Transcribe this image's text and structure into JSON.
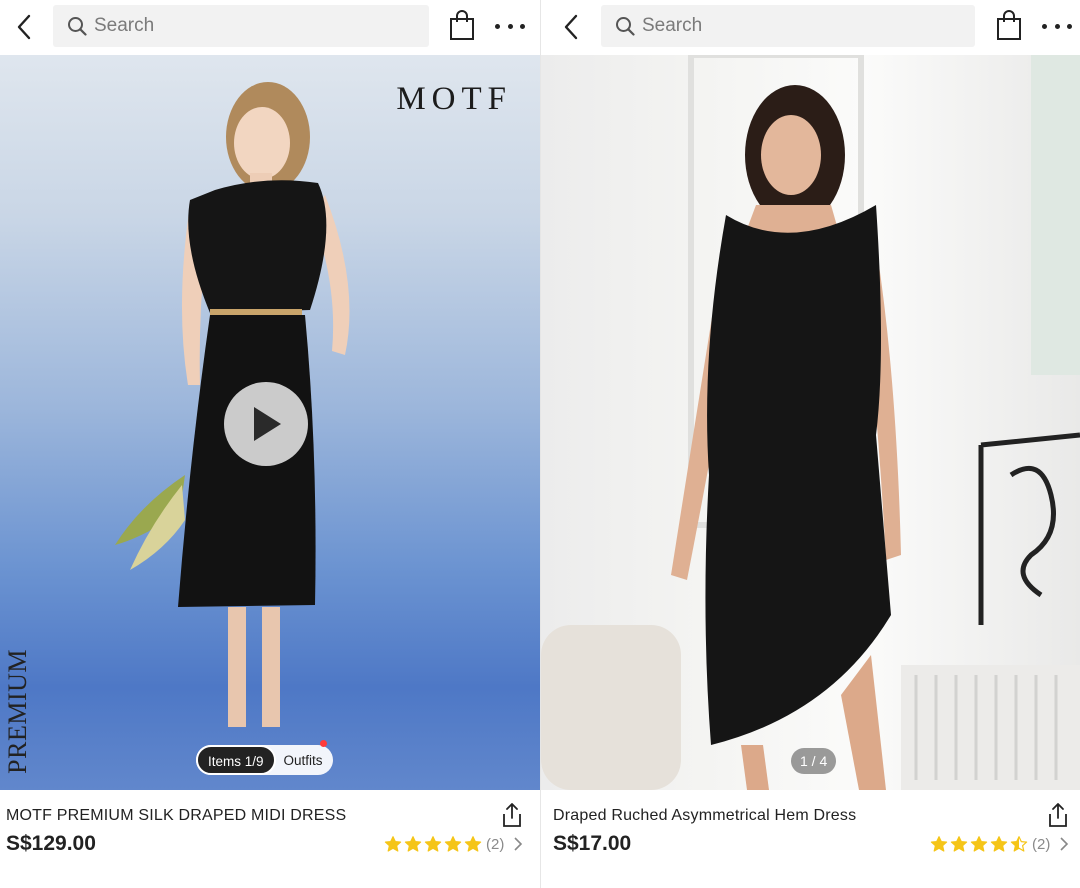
{
  "left": {
    "search": {
      "placeholder": "Search"
    },
    "brand_watermark": "MOTF",
    "premium_label": "PREMIUM",
    "pill": {
      "items_label": "Items 1/9",
      "outfits_label": "Outfits"
    },
    "product": {
      "title": "MOTF PREMIUM SILK DRAPED MIDI DRESS",
      "price": "S$129.00",
      "rating": 5,
      "review_count": "(2)"
    }
  },
  "right": {
    "search": {
      "placeholder": "Search"
    },
    "image_counter": "1 / 4",
    "product": {
      "title": "Draped Ruched Asymmetrical Hem Dress",
      "price": "S$17.00",
      "rating": 4.5,
      "review_count": "(2)"
    }
  },
  "colors": {
    "star": "#f5c518",
    "text": "#222222",
    "muted": "#8a8a8a",
    "search_bg": "#f2f2f2"
  }
}
